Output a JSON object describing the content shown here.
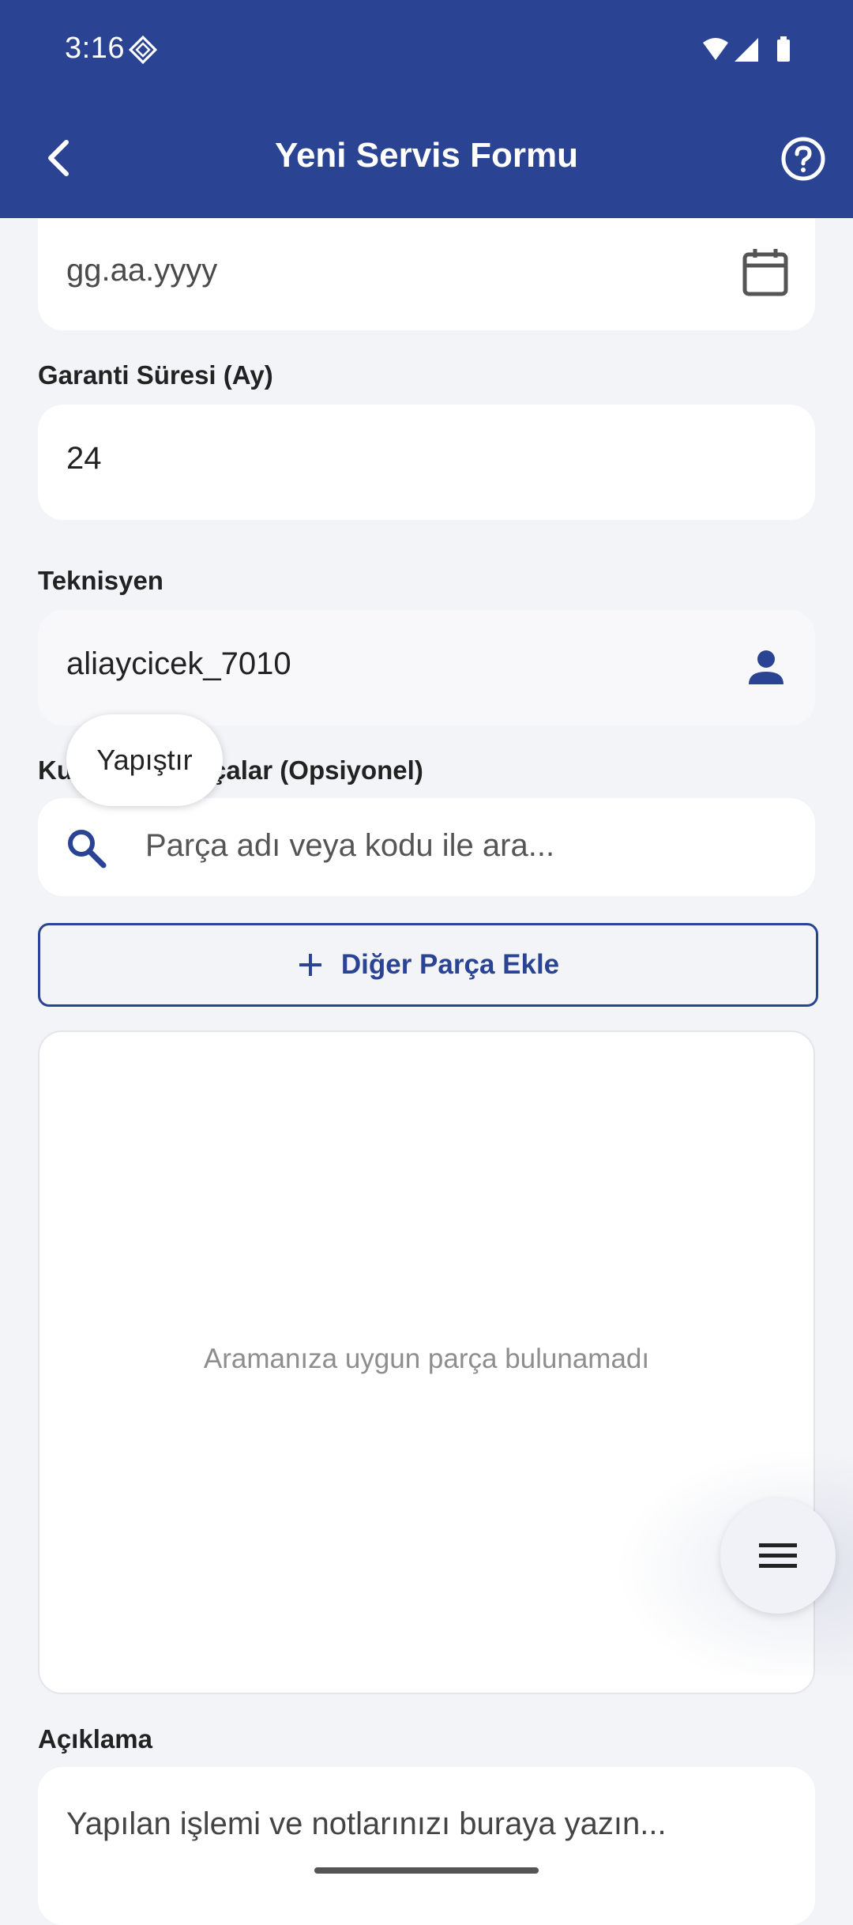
{
  "status_bar": {
    "time": "3:16"
  },
  "header": {
    "title": "Yeni Servis Formu"
  },
  "date_field": {
    "placeholder": "gg.aa.yyyy"
  },
  "warranty": {
    "label": "Garanti Süresi (Ay)",
    "value": "24"
  },
  "technician": {
    "label": "Teknisyen",
    "value": "aliaycicek_7010"
  },
  "parts": {
    "label": "Kullanılan Parçalar (Opsiyonel)",
    "search_placeholder": "Parça adı veya kodu ile ara...",
    "add_button": "Diğer Parça Ekle",
    "empty_message": "Aramanıza uygun parça bulunamadı"
  },
  "description": {
    "label": "Açıklama",
    "placeholder": "Yapılan işlemi ve notlarınızı buraya yazın..."
  },
  "context_menu": {
    "paste": "Yapıştır"
  },
  "icons": {
    "back": "back-icon",
    "help": "help-icon",
    "calendar": "calendar-icon",
    "person": "person-icon",
    "search": "search-icon",
    "add": "plus-icon",
    "menu": "menu-icon"
  },
  "colors": {
    "primary": "#2a4392",
    "background": "#f3f4f8",
    "field": "#ffffff"
  }
}
